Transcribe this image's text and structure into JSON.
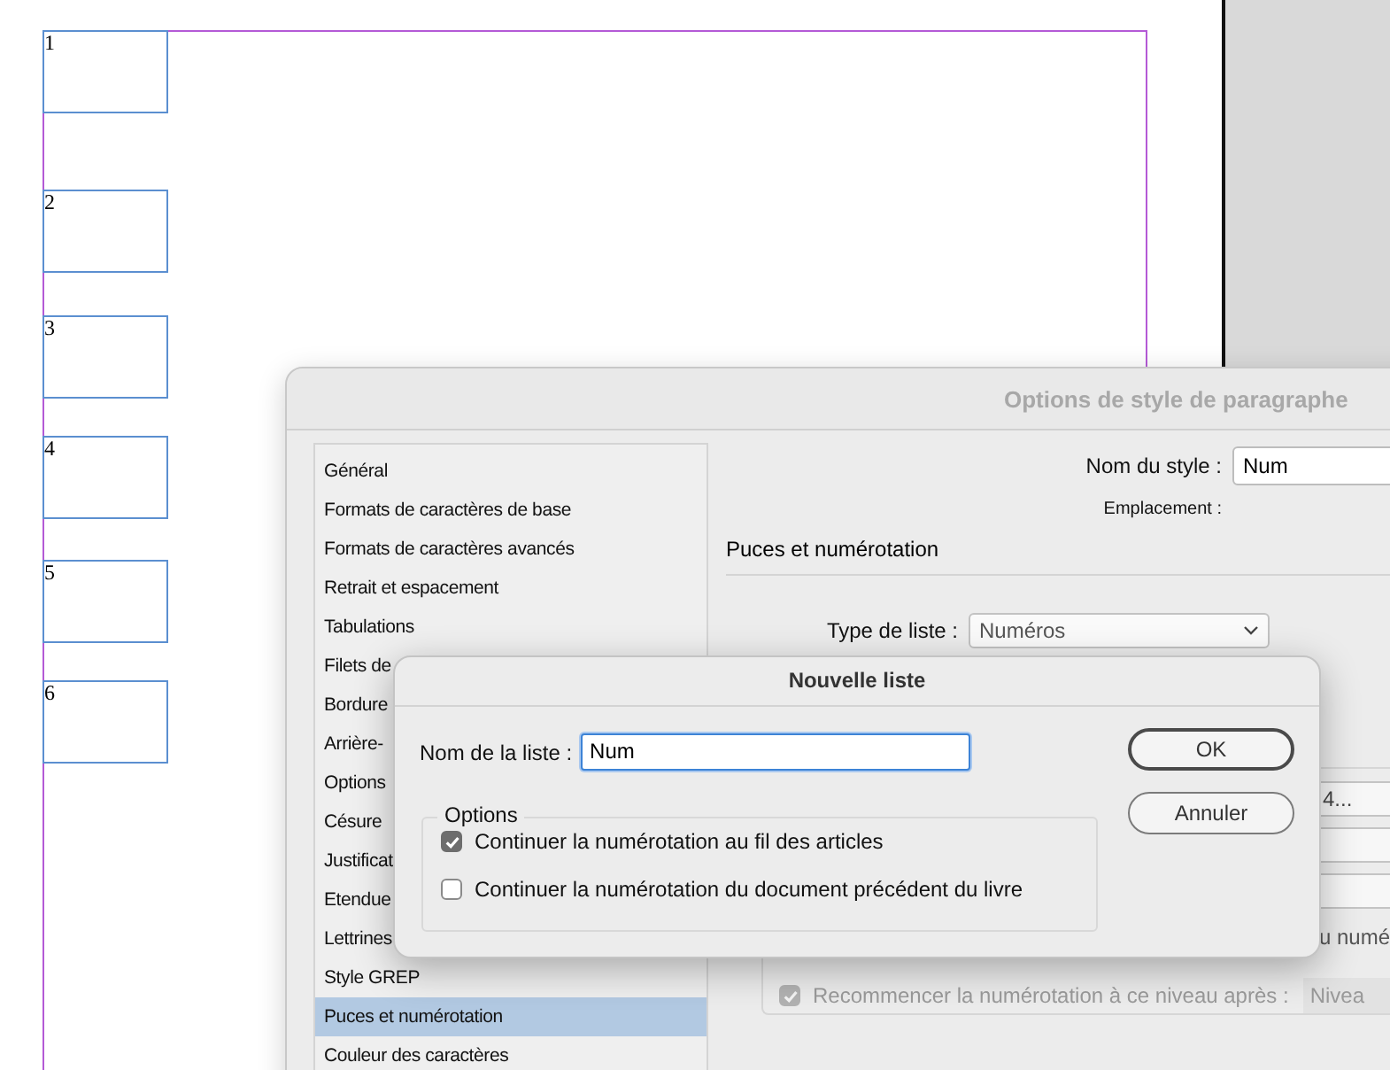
{
  "document": {
    "frames": [
      {
        "number": "1"
      },
      {
        "number": "2"
      },
      {
        "number": "3"
      },
      {
        "number": "4"
      },
      {
        "number": "5"
      },
      {
        "number": "6"
      }
    ]
  },
  "paragraph_style_dialog": {
    "title": "Options de style de paragraphe",
    "categories": [
      {
        "label": "Général",
        "selected": false
      },
      {
        "label": "Formats de caractères de base",
        "selected": false
      },
      {
        "label": "Formats de caractères avancés",
        "selected": false
      },
      {
        "label": "Retrait et espacement",
        "selected": false
      },
      {
        "label": "Tabulations",
        "selected": false
      },
      {
        "label": "Filets de",
        "selected": false
      },
      {
        "label": "Bordure",
        "selected": false
      },
      {
        "label": "Arrière-",
        "selected": false
      },
      {
        "label": "Options",
        "selected": false
      },
      {
        "label": "Césure",
        "selected": false
      },
      {
        "label": "Justificat",
        "selected": false
      },
      {
        "label": "Etendue",
        "selected": false
      },
      {
        "label": "Lettrines",
        "selected": false
      },
      {
        "label": "Style GREP",
        "selected": false
      },
      {
        "label": "Puces et numérotation",
        "selected": true
      },
      {
        "label": "Couleur des caractères",
        "selected": false
      }
    ],
    "style_name": {
      "label": "Nom du style :",
      "value": "Num"
    },
    "location_label": "Emplacement :",
    "section_title": "Puces et numérotation",
    "list_type": {
      "label": "Type de liste :",
      "value": "Numéros"
    },
    "fields": [
      {
        "kind": "text",
        "value": "4..."
      },
      {
        "kind": "empty"
      },
      {
        "kind": "empty"
      }
    ],
    "cut_label": "u numé",
    "restart": {
      "label": "Recommencer la numérotation à ce niveau après :",
      "checked": true,
      "disabled": true,
      "field": "Nivea"
    }
  },
  "new_list_dialog": {
    "title": "Nouvelle liste",
    "list_name": {
      "label": "Nom de la liste :",
      "value": "Num"
    },
    "options": {
      "legend": "Options",
      "items": [
        {
          "label": "Continuer la numérotation au fil des articles",
          "checked": true
        },
        {
          "label": "Continuer la numérotation du document précédent du livre",
          "checked": false
        }
      ]
    },
    "buttons": [
      {
        "label": "OK",
        "default": true
      },
      {
        "label": "Annuler",
        "default": false
      }
    ]
  }
}
